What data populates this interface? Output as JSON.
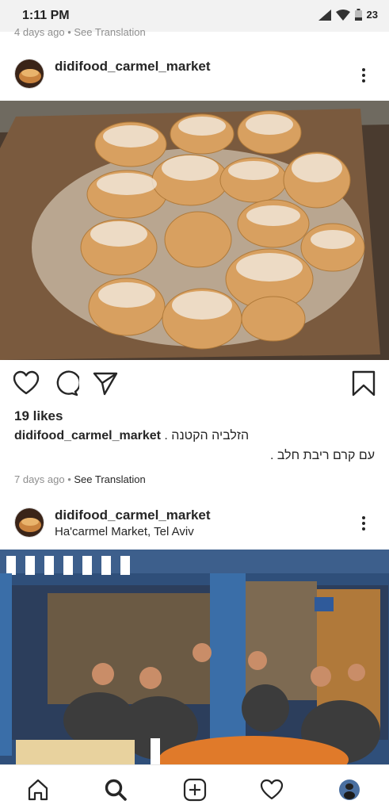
{
  "status_bar": {
    "time": "1:11 PM",
    "battery": "23"
  },
  "previous_post": {
    "caption_tail": "4 days ago • See Translation"
  },
  "posts": [
    {
      "username": "didifood_carmel_market",
      "location": "",
      "likes": "19 likes",
      "caption_username": "didifood_carmel_market",
      "caption_text": "הזלביה הקטנה .",
      "caption_text_line2": "עם קרם ריבת חלב .",
      "time_ago": "7 days ago",
      "separator": " • ",
      "see_translation": "See Translation"
    },
    {
      "username": "didifood_carmel_market",
      "location": "Ha'carmel Market, Tel Aviv"
    }
  ],
  "nav": {
    "items": [
      "home-icon",
      "search-icon",
      "add-icon",
      "heart-icon",
      "profile-avatar"
    ]
  },
  "colors": {
    "text": "#262626",
    "muted": "#8e8e8e",
    "status_bg": "#f2f2f2"
  }
}
